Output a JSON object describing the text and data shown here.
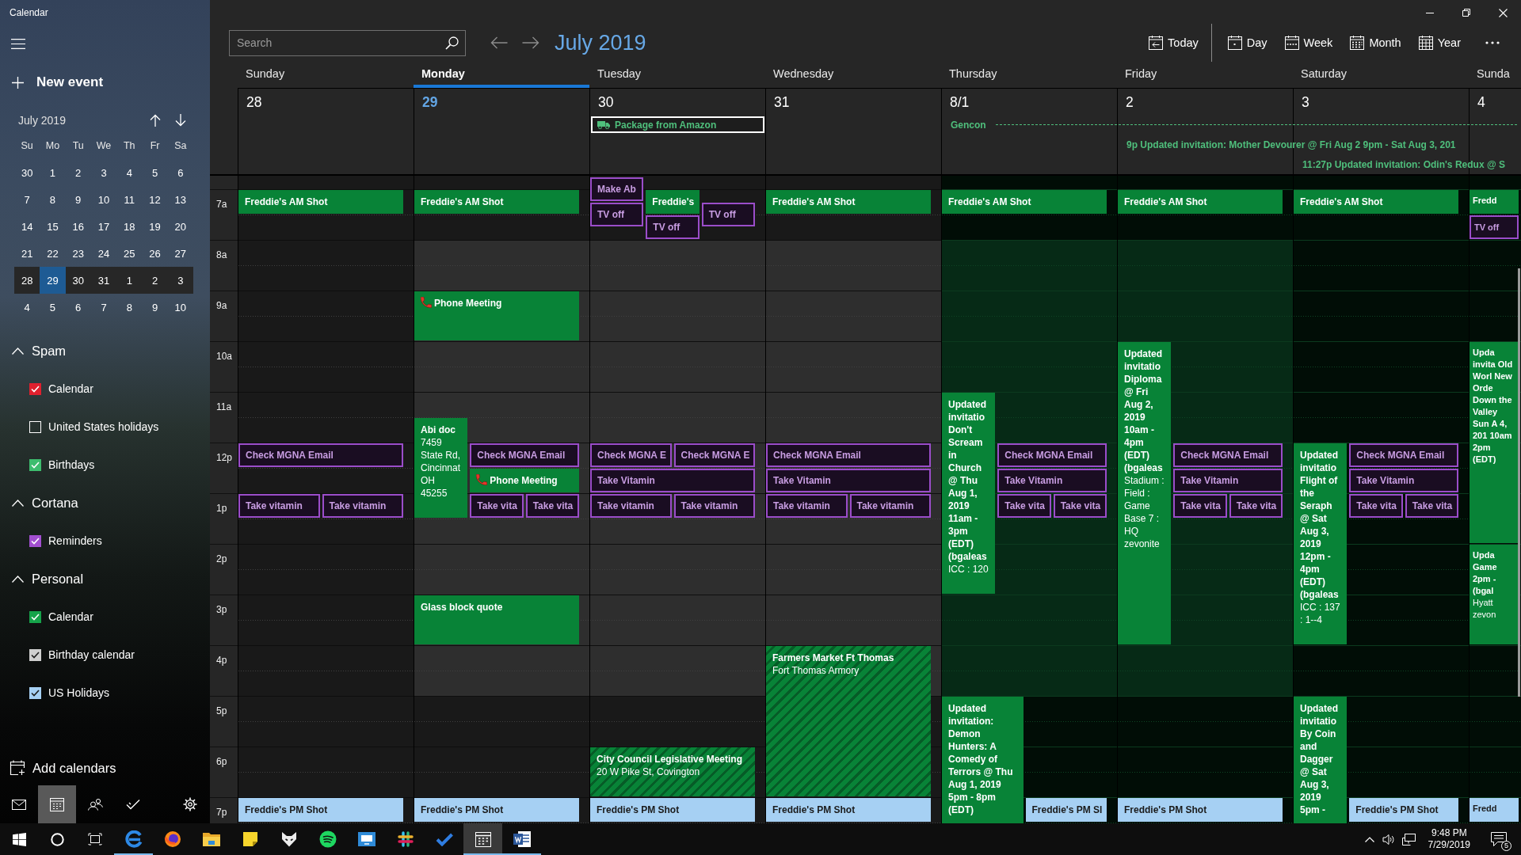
{
  "window": {
    "title": "Calendar"
  },
  "sidebar": {
    "new_event": "New event",
    "mini_calendar": {
      "title": "July 2019",
      "weekdays": [
        "Su",
        "Mo",
        "Tu",
        "We",
        "Th",
        "Fr",
        "Sa"
      ],
      "weeks": [
        {
          "selected": false,
          "days": [
            {
              "label": "30",
              "today": false
            },
            {
              "label": "1",
              "today": false
            },
            {
              "label": "2",
              "today": false
            },
            {
              "label": "3",
              "today": false
            },
            {
              "label": "4",
              "today": false
            },
            {
              "label": "5",
              "today": false
            },
            {
              "label": "6",
              "today": false
            }
          ]
        },
        {
          "selected": false,
          "days": [
            {
              "label": "7",
              "today": false
            },
            {
              "label": "8",
              "today": false
            },
            {
              "label": "9",
              "today": false
            },
            {
              "label": "10",
              "today": false
            },
            {
              "label": "11",
              "today": false
            },
            {
              "label": "12",
              "today": false
            },
            {
              "label": "13",
              "today": false
            }
          ]
        },
        {
          "selected": false,
          "days": [
            {
              "label": "14",
              "today": false
            },
            {
              "label": "15",
              "today": false
            },
            {
              "label": "16",
              "today": false
            },
            {
              "label": "17",
              "today": false
            },
            {
              "label": "18",
              "today": false
            },
            {
              "label": "19",
              "today": false
            },
            {
              "label": "20",
              "today": false
            }
          ]
        },
        {
          "selected": false,
          "days": [
            {
              "label": "21",
              "today": false
            },
            {
              "label": "22",
              "today": false
            },
            {
              "label": "23",
              "today": false
            },
            {
              "label": "24",
              "today": false
            },
            {
              "label": "25",
              "today": false
            },
            {
              "label": "26",
              "today": false
            },
            {
              "label": "27",
              "today": false
            }
          ]
        },
        {
          "selected": true,
          "days": [
            {
              "label": "28",
              "today": false
            },
            {
              "label": "29",
              "today": true
            },
            {
              "label": "30",
              "today": false
            },
            {
              "label": "31",
              "today": false
            },
            {
              "label": "1",
              "today": false
            },
            {
              "label": "2",
              "today": false
            },
            {
              "label": "3",
              "today": false
            }
          ]
        },
        {
          "selected": false,
          "days": [
            {
              "label": "4",
              "today": false
            },
            {
              "label": "5",
              "today": false
            },
            {
              "label": "6",
              "today": false
            },
            {
              "label": "7",
              "today": false
            },
            {
              "label": "8",
              "today": false
            },
            {
              "label": "9",
              "today": false
            },
            {
              "label": "10",
              "today": false
            }
          ]
        }
      ]
    },
    "groups": [
      {
        "name": "Spam",
        "expanded": true,
        "calendars": [
          {
            "name": "Calendar",
            "checked": true,
            "color": "#e0202e"
          },
          {
            "name": "United States holidays",
            "checked": false
          },
          {
            "name": "Birthdays",
            "checked": true,
            "color": "#3dbd6e"
          }
        ]
      },
      {
        "name": "Cortana",
        "expanded": true,
        "calendars": [
          {
            "name": "Reminders",
            "checked": true,
            "color": "#a24fd0"
          }
        ]
      },
      {
        "name": "Personal",
        "expanded": true,
        "calendars": [
          {
            "name": "Calendar",
            "checked": true,
            "color": "#16a34a"
          },
          {
            "name": "Birthday calendar",
            "checked": true,
            "color": "#cfcfcf"
          },
          {
            "name": "US Holidays",
            "checked": true,
            "color": "#a6d0f3"
          }
        ]
      }
    ],
    "add_calendars": "Add calendars",
    "nav": [
      {
        "kind": "mail",
        "selected": false
      },
      {
        "kind": "calendar",
        "selected": true
      },
      {
        "kind": "people",
        "selected": false
      },
      {
        "kind": "todo",
        "selected": false
      },
      {
        "kind": "settings",
        "selected": false
      }
    ]
  },
  "toolbar": {
    "search": {
      "placeholder": "Search"
    },
    "title": "July 2019",
    "views": [
      {
        "kind": "today",
        "label": "Today"
      },
      {
        "kind": "day",
        "label": "Day"
      },
      {
        "kind": "week",
        "label": "Week"
      },
      {
        "kind": "month",
        "label": "Month"
      },
      {
        "kind": "year",
        "label": "Year"
      }
    ]
  },
  "all_day": [
    {
      "kind": "package",
      "title": "Package from Amazon",
      "selected": true,
      "color": "#4fbf7c"
    },
    {
      "kind": "span",
      "title": "Gencon",
      "selected": false,
      "color": "#4fbf7c"
    },
    {
      "kind": "text",
      "title": "9p Updated invitation: Mother Devourer @ Fri Aug 2 9pm - Sat Aug 3, 201",
      "selected": false,
      "color": "#4fbf7c"
    },
    {
      "kind": "text",
      "title": "11:27p Updated invitation: Odin's Redux @ S",
      "selected": false,
      "color": "#4fbf7c"
    }
  ],
  "hours": [
    "7a",
    "8a",
    "9a",
    "10a",
    "11a",
    "12p",
    "1p",
    "2p",
    "3p",
    "4p",
    "5p",
    "6p",
    "7p"
  ],
  "days": [
    {
      "name": "Sunday",
      "date": "28",
      "selected": false,
      "workday": false,
      "busy": false,
      "events": [
        {
          "kind": "event",
          "title": "Freddie's AM Shot",
          "color": "#088337"
        },
        {
          "kind": "reminder",
          "title": "Check MGNA Email",
          "color": "#9b4dca"
        },
        {
          "kind": "reminder",
          "title": "Take vitamin",
          "color": "#9b4dca"
        },
        {
          "kind": "reminder",
          "title": "Take vitamin",
          "color": "#9b4dca"
        },
        {
          "kind": "event",
          "title": "Freddie's PM Shot",
          "color": "#a6d0f3"
        }
      ]
    },
    {
      "name": "Monday",
      "date": "29",
      "selected": true,
      "workday": true,
      "busy": false,
      "events": [
        {
          "kind": "event",
          "title": "Freddie's AM Shot",
          "color": "#088337"
        },
        {
          "kind": "call",
          "title": "Phone Meeting",
          "color": "#088337"
        },
        {
          "kind": "event",
          "title": "Abi doc",
          "location": "7459 State Rd, Cincinnat OH 45255",
          "color": "#088337"
        },
        {
          "kind": "reminder",
          "title": "Check MGNA Email",
          "color": "#9b4dca"
        },
        {
          "kind": "call",
          "title": "Phone Meeting",
          "color": "#088337"
        },
        {
          "kind": "reminder",
          "title": "Take vita",
          "color": "#9b4dca"
        },
        {
          "kind": "reminder",
          "title": "Take vita",
          "color": "#9b4dca"
        },
        {
          "kind": "event",
          "title": "Glass block quote",
          "color": "#088337"
        },
        {
          "kind": "event",
          "title": "Freddie's PM Shot",
          "color": "#a6d0f3"
        }
      ]
    },
    {
      "name": "Tuesday",
      "date": "30",
      "selected": false,
      "workday": true,
      "busy": false,
      "events": [
        {
          "kind": "reminder",
          "title": "Make Ab",
          "color": "#9b4dca"
        },
        {
          "kind": "event",
          "title": "Freddie's",
          "color": "#088337"
        },
        {
          "kind": "reminder",
          "title": "TV off",
          "color": "#9b4dca"
        },
        {
          "kind": "reminder",
          "title": "TV off",
          "color": "#9b4dca"
        },
        {
          "kind": "reminder",
          "title": "TV off",
          "color": "#9b4dca"
        },
        {
          "kind": "reminder",
          "title": "Check MGNA E",
          "color": "#9b4dca"
        },
        {
          "kind": "reminder",
          "title": "Check MGNA E",
          "color": "#9b4dca"
        },
        {
          "kind": "reminder",
          "title": "Take Vitamin",
          "color": "#9b4dca"
        },
        {
          "kind": "reminder",
          "title": "Take vitamin",
          "color": "#9b4dca"
        },
        {
          "kind": "reminder",
          "title": "Take vitamin",
          "color": "#9b4dca"
        },
        {
          "kind": "tentative",
          "title": "City Council Legislative Meeting",
          "location": "20 W Pike St, Covington",
          "color": "#088337"
        },
        {
          "kind": "event",
          "title": "Freddie's PM Shot",
          "color": "#a6d0f3"
        }
      ]
    },
    {
      "name": "Wednesday",
      "date": "31",
      "selected": false,
      "workday": true,
      "busy": false,
      "events": [
        {
          "kind": "event",
          "title": "Freddie's AM Shot",
          "color": "#088337"
        },
        {
          "kind": "reminder",
          "title": "Check MGNA Email",
          "color": "#9b4dca"
        },
        {
          "kind": "reminder",
          "title": "Take Vitamin",
          "color": "#9b4dca"
        },
        {
          "kind": "reminder",
          "title": "Take vitamin",
          "color": "#9b4dca"
        },
        {
          "kind": "reminder",
          "title": "Take vitamin",
          "color": "#9b4dca"
        },
        {
          "kind": "tentative",
          "title": "Farmers Market Ft Thomas",
          "location": "Fort Thomas Armory",
          "color": "#088337"
        },
        {
          "kind": "event",
          "title": "Freddie's PM Shot",
          "color": "#a6d0f3"
        }
      ]
    },
    {
      "name": "Thursday",
      "date": "8/1",
      "selected": false,
      "workday": true,
      "busy": true,
      "events": [
        {
          "kind": "event",
          "title": "Freddie's AM Shot",
          "color": "#088337"
        },
        {
          "kind": "event",
          "title": "Updated invitatio Don't Scream in Church @ Thu Aug 1, 2019 11am - 3pm (EDT) (bgaleas",
          "location": "ICC : 120",
          "color": "#088337"
        },
        {
          "kind": "reminder",
          "title": "Check MGNA Email",
          "color": "#9b4dca"
        },
        {
          "kind": "reminder",
          "title": "Take Vitamin",
          "color": "#9b4dca"
        },
        {
          "kind": "reminder",
          "title": "Take vita",
          "color": "#9b4dca"
        },
        {
          "kind": "reminder",
          "title": "Take vita",
          "color": "#9b4dca"
        },
        {
          "kind": "event",
          "title": "Updated invitation: Demon Hunters: A Comedy of Terrors @ Thu Aug 1, 2019 5pm - 8pm (EDT)",
          "color": "#088337"
        },
        {
          "kind": "event",
          "title": "Freddie's PM Sl",
          "color": "#a6d0f3"
        }
      ]
    },
    {
      "name": "Friday",
      "date": "2",
      "selected": false,
      "workday": true,
      "busy": true,
      "events": [
        {
          "kind": "event",
          "title": "Freddie's AM Shot",
          "color": "#088337"
        },
        {
          "kind": "event",
          "title": "Updated invitatio Diploma @ Fri Aug 2, 2019 10am - 4pm (EDT) (bgaleas",
          "location": "Stadium : Field : Game Base 7 : HQ zevonite",
          "color": "#088337"
        },
        {
          "kind": "reminder",
          "title": "Check MGNA Email",
          "color": "#9b4dca"
        },
        {
          "kind": "reminder",
          "title": "Take Vitamin",
          "color": "#9b4dca"
        },
        {
          "kind": "reminder",
          "title": "Take vita",
          "color": "#9b4dca"
        },
        {
          "kind": "reminder",
          "title": "Take vita",
          "color": "#9b4dca"
        },
        {
          "kind": "event",
          "title": "Freddie's PM Shot",
          "color": "#a6d0f3"
        }
      ]
    },
    {
      "name": "Saturday",
      "date": "3",
      "selected": false,
      "workday": false,
      "busy": true,
      "events": [
        {
          "kind": "event",
          "title": "Freddie's AM Shot",
          "color": "#088337"
        },
        {
          "kind": "event",
          "title": "Updated invitatio Flight of the Seraph @ Sat Aug 3, 2019 12pm - 4pm (EDT) (bgaleas",
          "location": "ICC : 137 : 1--4",
          "color": "#088337"
        },
        {
          "kind": "reminder",
          "title": "Check MGNA Email",
          "color": "#9b4dca"
        },
        {
          "kind": "reminder",
          "title": "Take Vitamin",
          "color": "#9b4dca"
        },
        {
          "kind": "reminder",
          "title": "Take vita",
          "color": "#9b4dca"
        },
        {
          "kind": "reminder",
          "title": "Take vita",
          "color": "#9b4dca"
        },
        {
          "kind": "event",
          "title": "Updated invitatio By Coin and Dagger @ Sat Aug 3, 2019 5pm -",
          "color": "#088337"
        },
        {
          "kind": "event",
          "title": "Freddie's PM Shot",
          "color": "#a6d0f3"
        }
      ]
    },
    {
      "name": "Sunda",
      "date": "4",
      "selected": false,
      "workday": false,
      "busy": true,
      "events": [
        {
          "kind": "event",
          "title": "Fredd",
          "color": "#088337"
        },
        {
          "kind": "reminder",
          "title": "TV off",
          "color": "#9b4dca"
        },
        {
          "kind": "event",
          "title": "Upda invita Old Worl New Orde Down the Valley Sun A 4, 201 10am 2pm (EDT)",
          "color": "#088337"
        },
        {
          "kind": "event",
          "title": "Upda Game 2pm - (bgal",
          "location": "Hyatt zevon",
          "color": "#088337"
        },
        {
          "kind": "event",
          "title": "Fredd",
          "color": "#a6d0f3"
        }
      ]
    }
  ],
  "taskbar": {
    "buttons": [
      {
        "kind": "start"
      },
      {
        "kind": "cortana"
      },
      {
        "kind": "task-view"
      }
    ],
    "apps": [
      {
        "kind": "edge",
        "running": true,
        "active": false
      },
      {
        "kind": "firefox",
        "running": false,
        "active": false
      },
      {
        "kind": "explorer",
        "running": false,
        "active": false
      },
      {
        "kind": "sticky-notes",
        "running": false,
        "active": false
      },
      {
        "kind": "mask",
        "running": false,
        "active": false
      },
      {
        "kind": "spotify",
        "running": false,
        "active": false
      },
      {
        "kind": "remote",
        "running": false,
        "active": false
      },
      {
        "kind": "slack",
        "running": false,
        "active": false
      },
      {
        "kind": "todo",
        "running": false,
        "active": false
      },
      {
        "kind": "calendar",
        "running": true,
        "active": true
      },
      {
        "kind": "word",
        "running": true,
        "active": false
      }
    ],
    "tray": {
      "time": "9:48 PM",
      "date": "7/29/2019",
      "notifications": "5"
    }
  }
}
